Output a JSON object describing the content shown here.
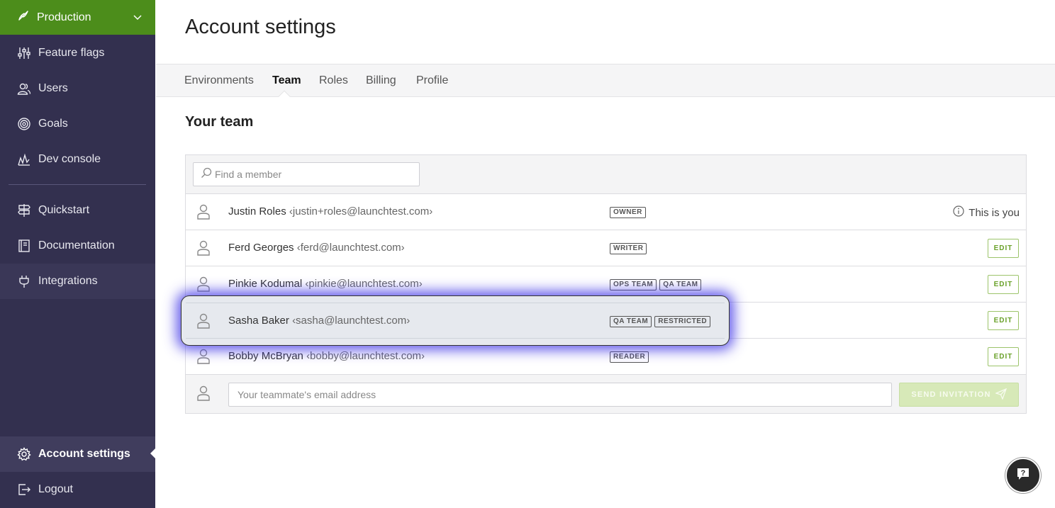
{
  "sidebar": {
    "environment": {
      "label": "Production",
      "icon": "check-feather-icon"
    },
    "items": [
      {
        "label": "Feature flags",
        "icon": "sliders-icon"
      },
      {
        "label": "Users",
        "icon": "users-icon"
      },
      {
        "label": "Goals",
        "icon": "target-icon"
      },
      {
        "label": "Dev console",
        "icon": "chart-icon"
      },
      {
        "label": "Quickstart",
        "icon": "signpost-icon"
      },
      {
        "label": "Documentation",
        "icon": "book-icon"
      },
      {
        "label": "Integrations",
        "icon": "plug-icon"
      },
      {
        "label": "Account settings",
        "icon": "gear-icon"
      },
      {
        "label": "Logout",
        "icon": "logout-icon"
      }
    ]
  },
  "page": {
    "title": "Account settings"
  },
  "tabs": [
    {
      "label": "Environments"
    },
    {
      "label": "Team"
    },
    {
      "label": "Roles"
    },
    {
      "label": "Billing"
    },
    {
      "label": "Profile"
    }
  ],
  "team": {
    "title": "Your team",
    "search_placeholder": "Find a member",
    "members": [
      {
        "name": "Justin Roles",
        "email": "‹justin+roles@launchtest.com›",
        "badges": [
          "OWNER"
        ],
        "action": "This is you"
      },
      {
        "name": "Ferd Georges",
        "email": "‹ferd@launchtest.com›",
        "badges": [
          "WRITER"
        ],
        "action": "EDIT"
      },
      {
        "name": "Pinkie Kodumal",
        "email": "‹pinkie@launchtest.com›",
        "badges": [
          "OPS TEAM",
          "QA TEAM"
        ],
        "action": "EDIT"
      },
      {
        "name": "Sasha Baker",
        "email": "‹sasha@launchtest.com›",
        "badges": [
          "QA TEAM",
          "RESTRICTED"
        ],
        "action": "EDIT"
      },
      {
        "name": "Bobby McBryan",
        "email": "‹bobby@launchtest.com›",
        "badges": [
          "READER"
        ],
        "action": "EDIT"
      }
    ],
    "invite_placeholder": "Your teammate's email address",
    "send_label": "SEND INVITATION"
  },
  "colors": {
    "env_green": "#4c8d1b",
    "sidebar_bg": "#33304f",
    "edit_green": "#6aa12a",
    "highlight_glow": "#463ce6"
  }
}
